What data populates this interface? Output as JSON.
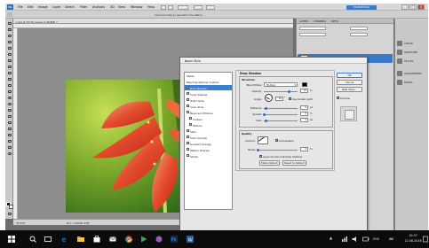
{
  "app": {
    "menu": [
      "File",
      "Edit",
      "Image",
      "Layer",
      "Select",
      "Filter",
      "Analysis",
      "3D",
      "View",
      "Window",
      "Help"
    ],
    "workspace_button": "ESSENTIALS",
    "option_hint": "Click and drag to reposition the effect.",
    "doc_tab": "1.jpg @ 33.3% (Layer 0, RGB/8) *",
    "status_zoom": "33.33%",
    "status_doc": "Doc: 1.43M/1.43M"
  },
  "right_panel": {
    "tabs": [
      "LAYERS",
      "CHANNELS",
      "PATHS"
    ],
    "icons": [
      {
        "icon": "color-panel-icon",
        "label": "COLOR"
      },
      {
        "icon": "swatches-icon",
        "label": "SWATCHES"
      },
      {
        "icon": "styles-icon",
        "label": "STYLES"
      },
      {
        "icon": "adjustments-icon",
        "label": "ADJUSTMENTS"
      },
      {
        "icon": "masks-icon",
        "label": "MASKS"
      }
    ]
  },
  "dialog": {
    "title": "Layer Style",
    "styles_header": "Styles",
    "blending_options": "Blending Options: Custom",
    "styles": [
      {
        "label": "Drop Shadow",
        "checked": true,
        "selected": true,
        "sub": false
      },
      {
        "label": "Inner Shadow",
        "checked": false,
        "selected": false,
        "sub": false
      },
      {
        "label": "Outer Glow",
        "checked": false,
        "selected": false,
        "sub": false
      },
      {
        "label": "Inner Glow",
        "checked": false,
        "selected": false,
        "sub": false
      },
      {
        "label": "Bevel and Emboss",
        "checked": false,
        "selected": false,
        "sub": false
      },
      {
        "label": "Contour",
        "checked": false,
        "selected": false,
        "sub": true
      },
      {
        "label": "Texture",
        "checked": false,
        "selected": false,
        "sub": true
      },
      {
        "label": "Satin",
        "checked": false,
        "selected": false,
        "sub": false
      },
      {
        "label": "Color Overlay",
        "checked": false,
        "selected": false,
        "sub": false
      },
      {
        "label": "Gradient Overlay",
        "checked": false,
        "selected": false,
        "sub": false
      },
      {
        "label": "Pattern Overlay",
        "checked": false,
        "selected": false,
        "sub": false
      },
      {
        "label": "Stroke",
        "checked": false,
        "selected": false,
        "sub": false
      }
    ],
    "section_title": "Drop Shadow",
    "structure": {
      "label": "Structure",
      "blend_mode_label": "Blend Mode:",
      "blend_mode": "Multiply",
      "shadow_color": "#000000",
      "opacity_label": "Opacity:",
      "opacity": "75",
      "angle_label": "Angle:",
      "angle": "30",
      "global_light_label": "Use Global Light",
      "distance_label": "Distance:",
      "distance": "5",
      "spread_label": "Spread:",
      "spread": "0",
      "size_label": "Size:",
      "size": "5",
      "percent": "%",
      "px": "px",
      "degree": "°"
    },
    "quality": {
      "label": "Quality",
      "contour_label": "Contour:",
      "anti_aliased_label": "Anti-aliased",
      "noise_label": "Noise:",
      "noise": "0",
      "knockout_label": "Layer Knocks Out Drop Shadow",
      "make_default": "Make Default",
      "reset_default": "Reset to Default"
    },
    "buttons": {
      "ok": "OK",
      "cancel": "Cancel",
      "new_style": "New Style...",
      "preview": "Preview"
    }
  },
  "taskbar": {
    "time": "10:57",
    "date": "12.08.2018",
    "lang": "ENG"
  }
}
